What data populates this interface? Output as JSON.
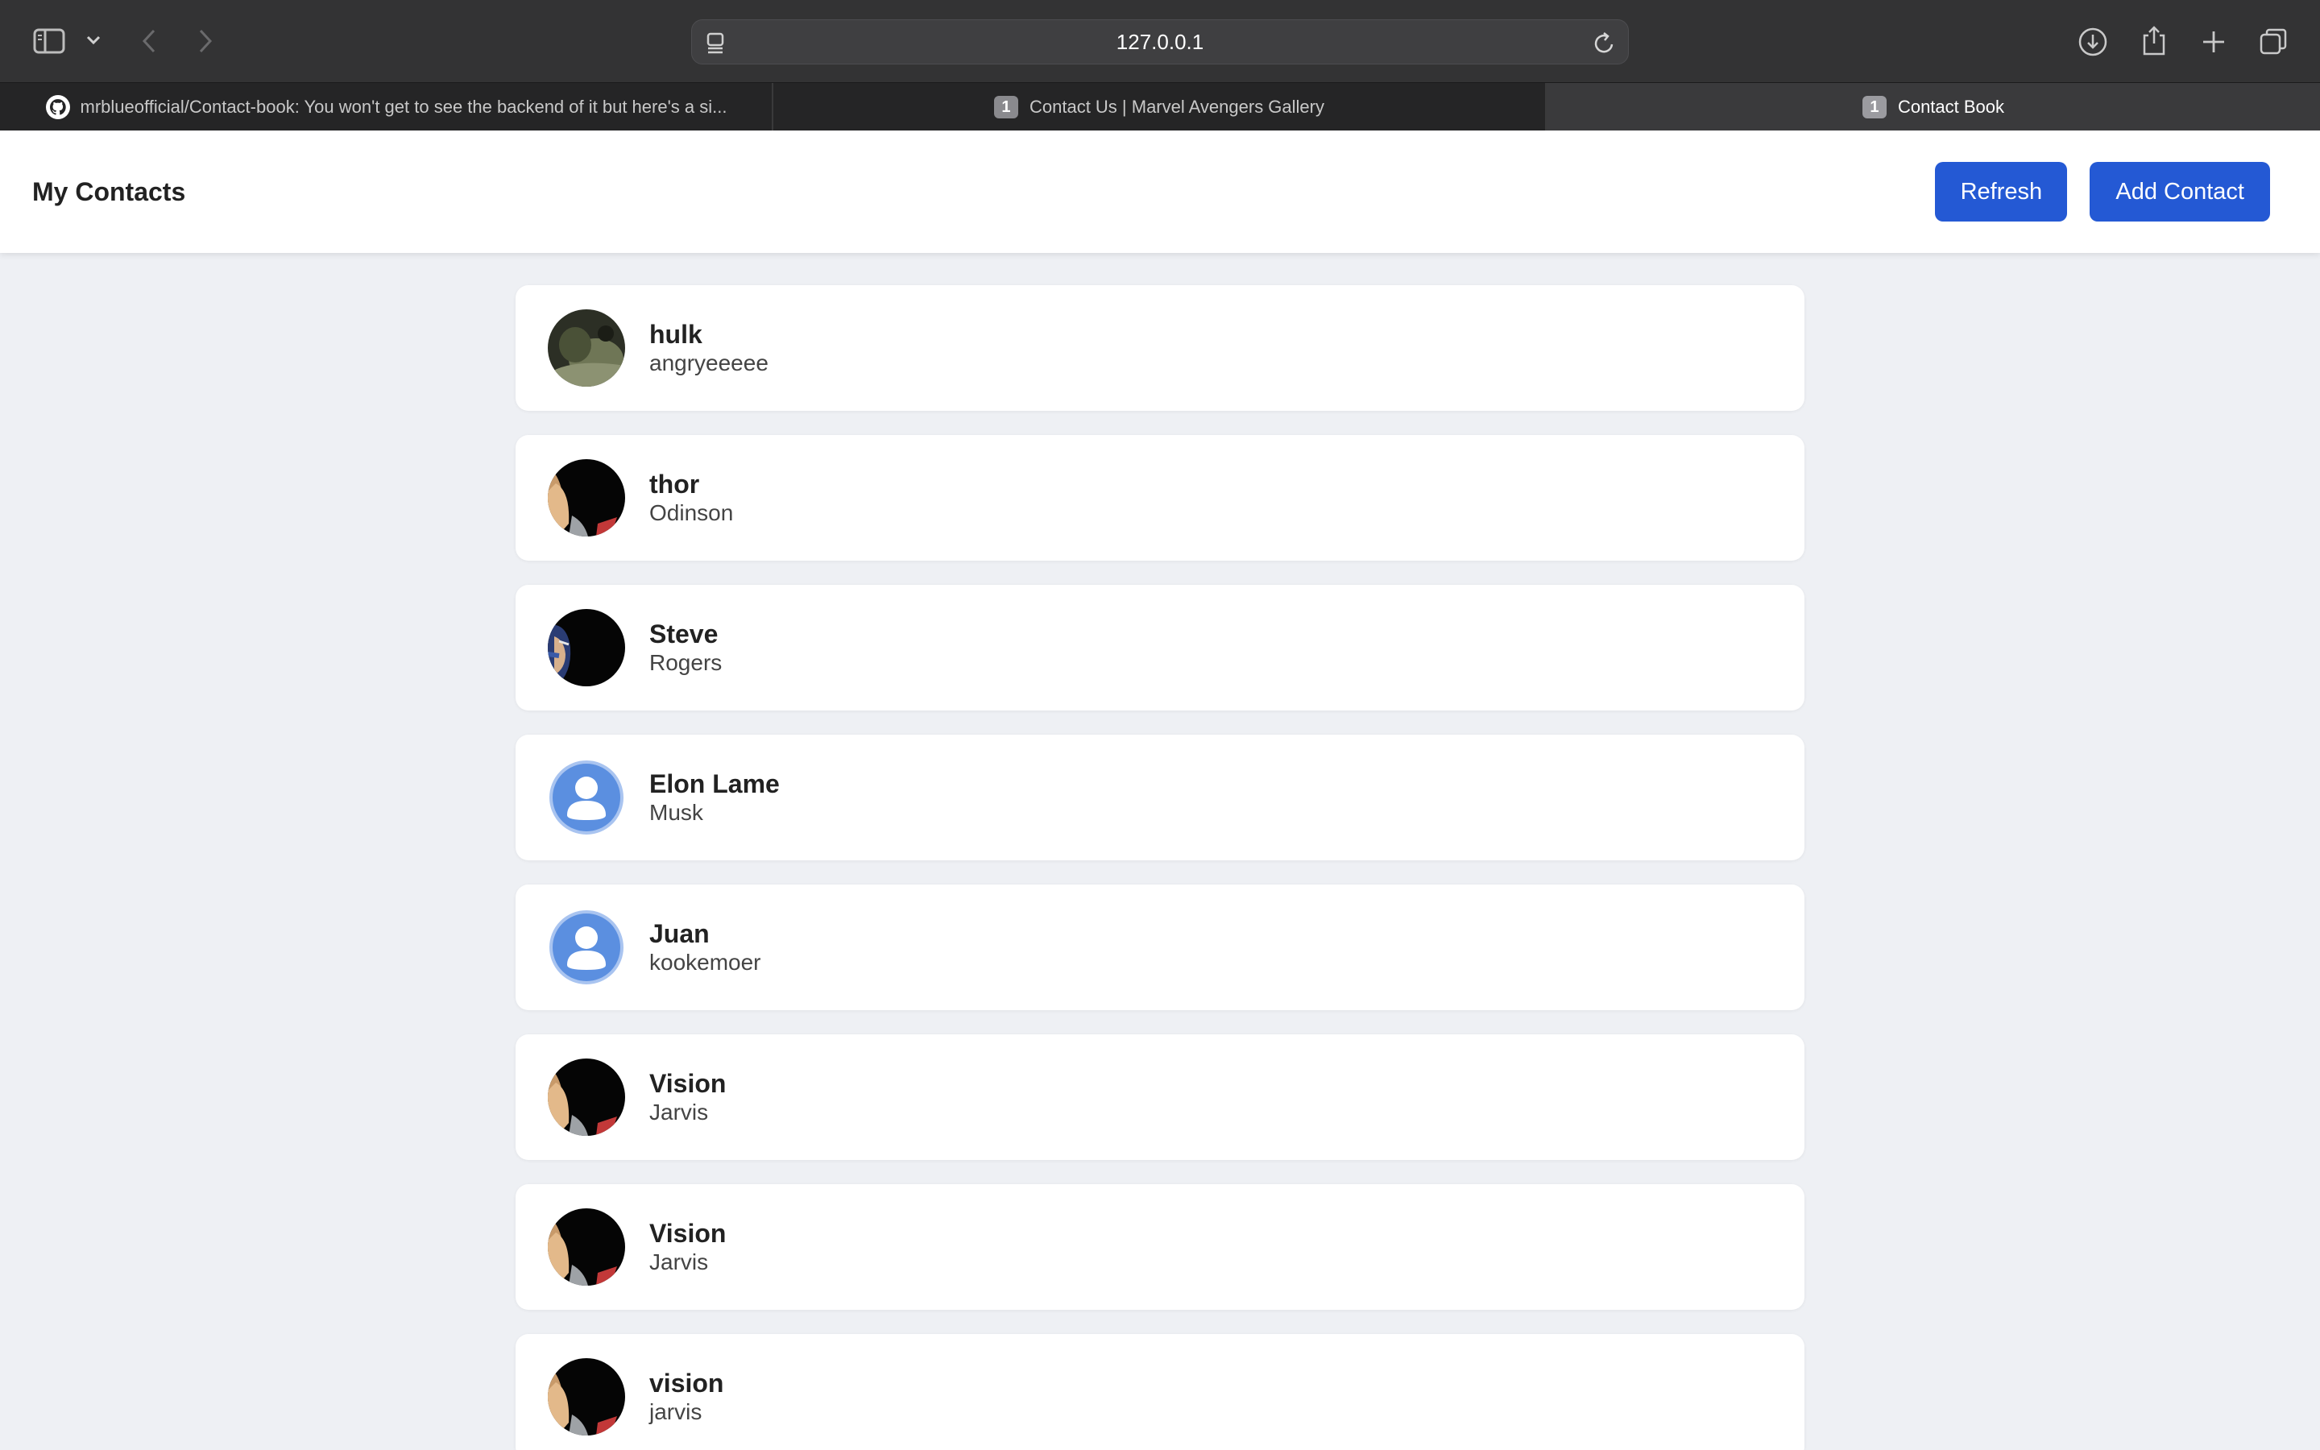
{
  "browser": {
    "url": "127.0.0.1",
    "tabs": [
      {
        "label": "mrblueofficial/Contact-book: You won't get to see the backend of it but here's a si...",
        "icon": "github-icon",
        "active": false
      },
      {
        "label": "Contact Us | Marvel Avengers Gallery",
        "badge": "1",
        "active": false
      },
      {
        "label": "Contact Book",
        "badge": "1",
        "active": true
      }
    ]
  },
  "app": {
    "title": "My Contacts",
    "refresh_label": "Refresh",
    "add_label": "Add Contact",
    "accent_color": "#2459d4"
  },
  "contacts": [
    {
      "name": "hulk",
      "sub": "angryeeeee",
      "avatar": "hulk-photo"
    },
    {
      "name": "thor",
      "sub": "Odinson",
      "avatar": "thor-photo"
    },
    {
      "name": "Steve",
      "sub": "Rogers",
      "avatar": "steve-photo"
    },
    {
      "name": "Elon Lame",
      "sub": "Musk",
      "avatar": "default-person-icon"
    },
    {
      "name": "Juan",
      "sub": "kookemoer",
      "avatar": "default-person-icon"
    },
    {
      "name": "Vision",
      "sub": "Jarvis",
      "avatar": "thor-photo"
    },
    {
      "name": "Vision",
      "sub": "Jarvis",
      "avatar": "thor-photo"
    },
    {
      "name": "vision",
      "sub": "jarvis",
      "avatar": "thor-photo"
    }
  ]
}
